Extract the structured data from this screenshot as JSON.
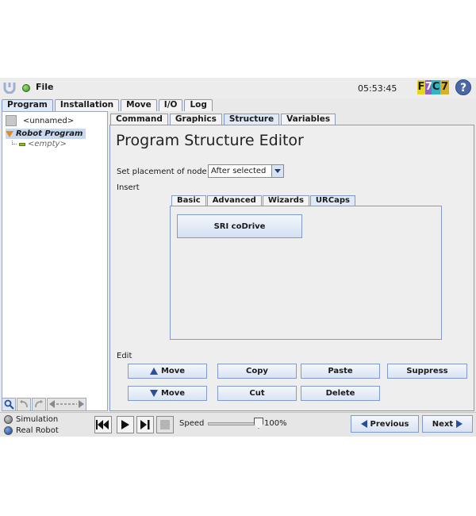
{
  "topbar": {
    "logo_icon": "ur-logo-icon",
    "file_label": "File",
    "clock": "05:53:45",
    "version_badge": {
      "f": "F",
      "seven": "7",
      "c": "C",
      "seven2": "7",
      "colors": {
        "f": "#e7d51a",
        "seven": "#8f5fc7",
        "c": "#32b3c2",
        "seven2": "#d8b020"
      }
    },
    "help_label": "?"
  },
  "main_tabs": [
    {
      "label": "Program",
      "active": true
    },
    {
      "label": "Installation"
    },
    {
      "label": "Move"
    },
    {
      "label": "I/O"
    },
    {
      "label": "Log"
    }
  ],
  "program_panel": {
    "program_name": "<unnamed>",
    "tree_root": "Robot Program",
    "tree_empty": "<empty>"
  },
  "sub_tabs": [
    {
      "label": "Command"
    },
    {
      "label": "Graphics"
    },
    {
      "label": "Structure",
      "active": true
    },
    {
      "label": "Variables"
    }
  ],
  "editor": {
    "title": "Program Structure Editor",
    "placement_label": "Set placement of node",
    "placement_value": "After selected",
    "insert_label": "Insert",
    "insert_tabs": [
      {
        "label": "Basic"
      },
      {
        "label": "Advanced"
      },
      {
        "label": "Wizards"
      },
      {
        "label": "URCaps",
        "active": true
      }
    ],
    "urcap_button": "SRI coDrive",
    "edit_label": "Edit",
    "edit_buttons": {
      "move_up": "Move",
      "copy": "Copy",
      "paste": "Paste",
      "suppress": "Suppress",
      "move_down": "Move",
      "cut": "Cut",
      "delete": "Delete"
    }
  },
  "bottom": {
    "simulation_label": "Simulation",
    "real_robot_label": "Real Robot",
    "speed_label": "Speed",
    "speed_value": "100%",
    "previous_label": "Previous",
    "next_label": "Next"
  },
  "colors": {
    "accent": "#2a4f9a",
    "tab_border": "#7f9acb",
    "panel_bg": "#eeeeee",
    "tree_triangle": "#e68a1e",
    "status_green": "#2f8f1a"
  }
}
